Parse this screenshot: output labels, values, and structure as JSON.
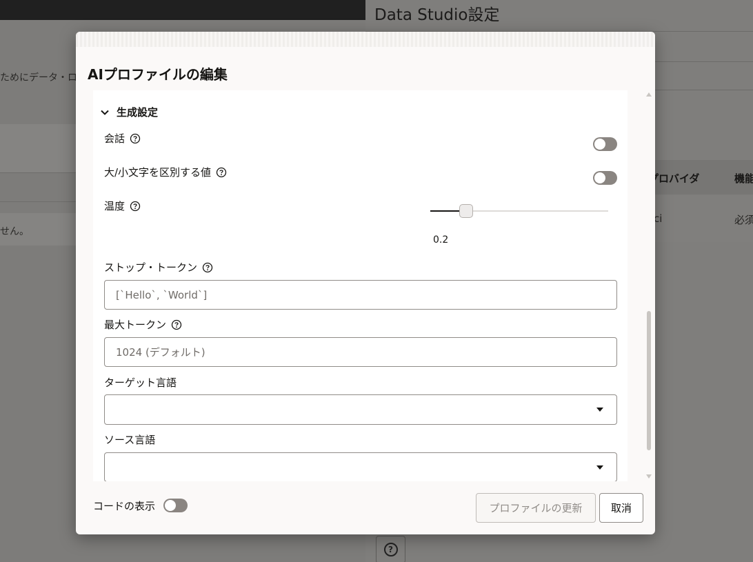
{
  "background": {
    "left_text_1": "ためにデータ・ロ",
    "left_text_2": "せん。",
    "panel_title": "Data Studio設定",
    "table_headers": [
      "プロバイダ",
      "機能"
    ],
    "table_row": [
      "ci",
      "必須"
    ]
  },
  "modal": {
    "title": "AIプロファイルの編集",
    "section": {
      "title": "生成設定",
      "conversation_label": "会話",
      "case_sensitive_label": "大/小文字を区別する値",
      "temperature_label": "温度",
      "temperature_value": "0.2",
      "temperature_fraction": 0.2,
      "stop_tokens_label": "ストップ・トークン",
      "stop_tokens_placeholder": "[`Hello`, `World`]",
      "max_tokens_label": "最大トークン",
      "max_tokens_placeholder": "1024 (デフォルト)",
      "target_language_label": "ターゲット言語",
      "target_language_value": "",
      "source_language_label": "ソース言語",
      "source_language_value": ""
    },
    "footer": {
      "show_code_label": "コードの表示",
      "update_button": "プロファイルの更新",
      "cancel_button": "取消"
    }
  },
  "colors": {
    "toggle_off": "#8a8581",
    "modal_bg": "#fbf9f8",
    "text": "#161513"
  },
  "icons": {
    "help": "help-circle-icon",
    "chevron": "chevron-down-icon",
    "select_caret": "caret-down-icon"
  }
}
